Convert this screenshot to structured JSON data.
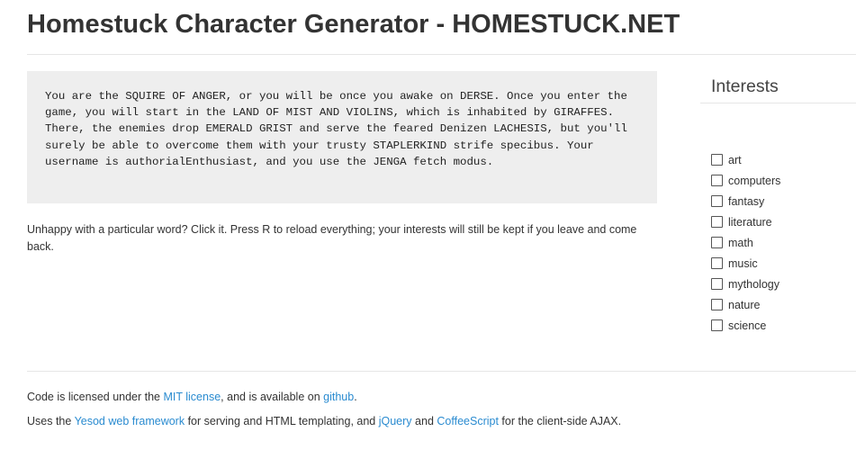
{
  "header": {
    "title": "Homestuck Character Generator - HOMESTUCK.NET"
  },
  "main": {
    "story": "You are the SQUIRE OF ANGER, or you will be once you awake on DERSE. Once you enter the game, you will start in the LAND OF MIST AND VIOLINS, which is inhabited by GIRAFFES. There, the enemies drop EMERALD GRIST and serve the feared Denizen LACHESIS, but you'll surely be able to overcome them with your trusty STAPLERKIND strife specibus. Your username is authorialEnthusiast, and you use the JENGA fetch modus.",
    "hint": "Unhappy with a particular word? Click it. Press R to reload everything; your interests will still be kept if you leave and come back."
  },
  "sidebar": {
    "title": "Interests",
    "items": [
      {
        "label": "art",
        "checked": false
      },
      {
        "label": "computers",
        "checked": false
      },
      {
        "label": "fantasy",
        "checked": false
      },
      {
        "label": "literature",
        "checked": false
      },
      {
        "label": "math",
        "checked": false
      },
      {
        "label": "music",
        "checked": false
      },
      {
        "label": "mythology",
        "checked": false
      },
      {
        "label": "nature",
        "checked": false
      },
      {
        "label": "science",
        "checked": false
      }
    ]
  },
  "footer": {
    "line1": {
      "prefix": "Code is licensed under the ",
      "license_link": "MIT license",
      "middle": ", and is available on ",
      "github_link": "github",
      "suffix": "."
    },
    "line2": {
      "prefix": "Uses the ",
      "yesod_link": "Yesod web framework",
      "middle1": " for serving and HTML templating, and ",
      "jquery_link": "jQuery",
      "middle2": " and ",
      "coffeescript_link": "CoffeeScript",
      "suffix": " for the client-side AJAX."
    }
  },
  "colors": {
    "link": "#2a8bd0",
    "story_background": "#eeeeee",
    "text": "#333333"
  }
}
